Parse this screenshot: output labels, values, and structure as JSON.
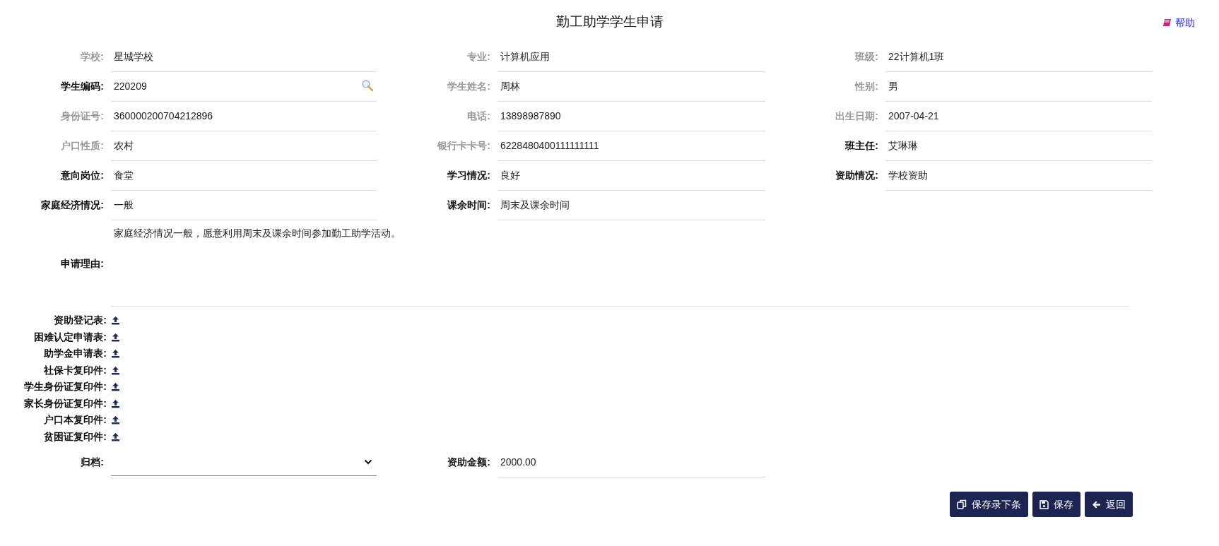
{
  "title": "勤工助学学生申请",
  "help": {
    "label": "帮助"
  },
  "rows": [
    [
      {
        "label": "学校:",
        "value": "星城学校",
        "readonly": true,
        "kind": "text"
      },
      {
        "label": "专业:",
        "value": "计算机应用",
        "readonly": true,
        "kind": "text"
      },
      {
        "label": "班级:",
        "value": "22计算机1班",
        "readonly": true,
        "kind": "text"
      }
    ],
    [
      {
        "label": "学生编码:",
        "value": "220209",
        "readonly": false,
        "kind": "lookup"
      },
      {
        "label": "学生姓名:",
        "value": "周林",
        "readonly": true,
        "kind": "text"
      },
      {
        "label": "性别:",
        "value": "男",
        "readonly": true,
        "kind": "text"
      }
    ],
    [
      {
        "label": "身份证号:",
        "value": "360000200704212896",
        "readonly": true,
        "kind": "text"
      },
      {
        "label": "电话:",
        "value": "13898987890",
        "readonly": true,
        "kind": "text"
      },
      {
        "label": "出生日期:",
        "value": "2007-04-21",
        "readonly": true,
        "kind": "text"
      }
    ],
    [
      {
        "label": "户口性质:",
        "value": "农村",
        "readonly": true,
        "kind": "text"
      },
      {
        "label": "银行卡卡号:",
        "value": "6228480400111111111",
        "readonly": true,
        "kind": "text"
      },
      {
        "label": "班主任:",
        "value": "艾琳琳",
        "readonly": false,
        "kind": "text"
      }
    ],
    [
      {
        "label": "意向岗位:",
        "value": "食堂",
        "readonly": false,
        "kind": "text"
      },
      {
        "label": "学习情况:",
        "value": "良好",
        "readonly": false,
        "kind": "text"
      },
      {
        "label": "资助情况:",
        "value": "学校资助",
        "readonly": false,
        "kind": "text"
      }
    ],
    [
      {
        "label": "家庭经济情况:",
        "value": "一般",
        "readonly": false,
        "kind": "text"
      },
      {
        "label": "课余时间:",
        "value": "周末及课余时间",
        "readonly": false,
        "kind": "text"
      }
    ]
  ],
  "reason": {
    "label": "申请理由:",
    "value": "家庭经济情况一般，愿意利用周末及课余时间参加勤工助学活动。"
  },
  "attachments": [
    "资助登记表:",
    "困难认定申请表:",
    "助学金申请表:",
    "社保卡复印件:",
    "学生身份证复印件:",
    "家长身份证复印件:",
    "户口本复印件:",
    "贫困证复印件:"
  ],
  "archive": {
    "label": "归档:"
  },
  "amount": {
    "label": "资助金额:",
    "value": "2000.00"
  },
  "buttons": [
    {
      "label": "保存录下条",
      "kind": "copy"
    },
    {
      "label": "保存",
      "kind": "save"
    },
    {
      "label": "返回",
      "kind": "back"
    }
  ]
}
